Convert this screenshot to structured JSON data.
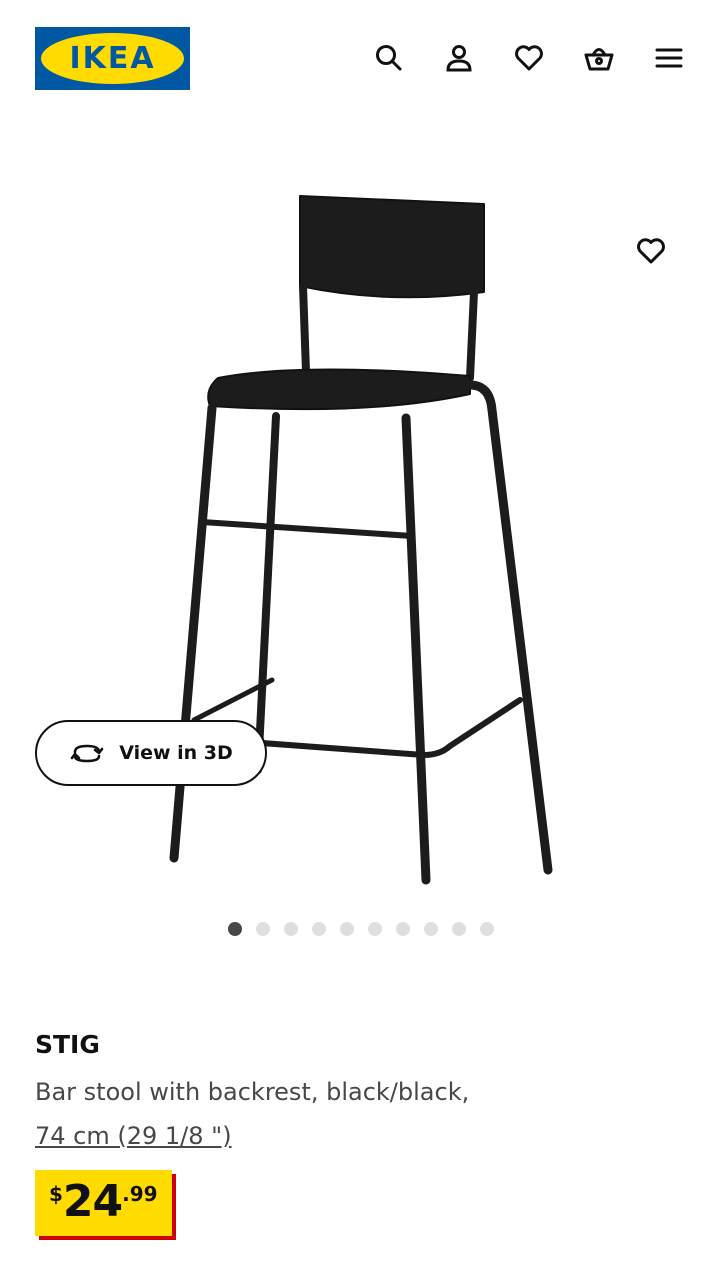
{
  "header": {
    "logo_text": "IKEA",
    "icons": [
      "search-icon",
      "user-icon",
      "heart-icon",
      "basket-icon",
      "menu-icon"
    ]
  },
  "gallery": {
    "view_3d_label": "View in 3D",
    "dots_total": 10,
    "active_dot": 1
  },
  "product": {
    "name": "STIG",
    "description": "Bar stool with backrest, black/black,",
    "measurement": "74 cm (29 1/8 \")",
    "price": {
      "currency": "$",
      "whole": "24",
      "decimal": ".99"
    }
  },
  "colors": {
    "brand_blue": "#0058a3",
    "brand_yellow": "#ffdb00",
    "price_shadow_red": "#cc0008"
  }
}
